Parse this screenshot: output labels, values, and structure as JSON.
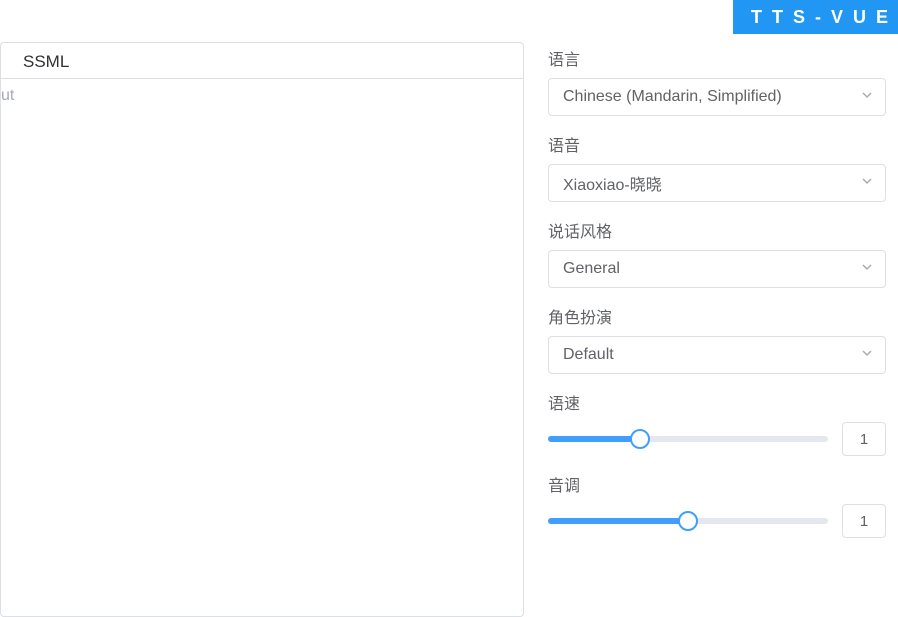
{
  "brand": "TTS-VUE",
  "tabs": {
    "ssml": "SSML"
  },
  "textarea": {
    "placeholder": "ut"
  },
  "settings": {
    "language": {
      "label": "语言",
      "value": "Chinese (Mandarin, Simplified)"
    },
    "voice": {
      "label": "语音",
      "value": "Xiaoxiao-晓晓"
    },
    "style": {
      "label": "说话风格",
      "value": "General"
    },
    "role": {
      "label": "角色扮演",
      "value": "Default"
    },
    "speed": {
      "label": "语速",
      "value": "1",
      "fill_percent": 33,
      "thumb_percent": 33
    },
    "pitch": {
      "label": "音调",
      "value": "1",
      "fill_percent": 50,
      "thumb_percent": 50
    }
  }
}
